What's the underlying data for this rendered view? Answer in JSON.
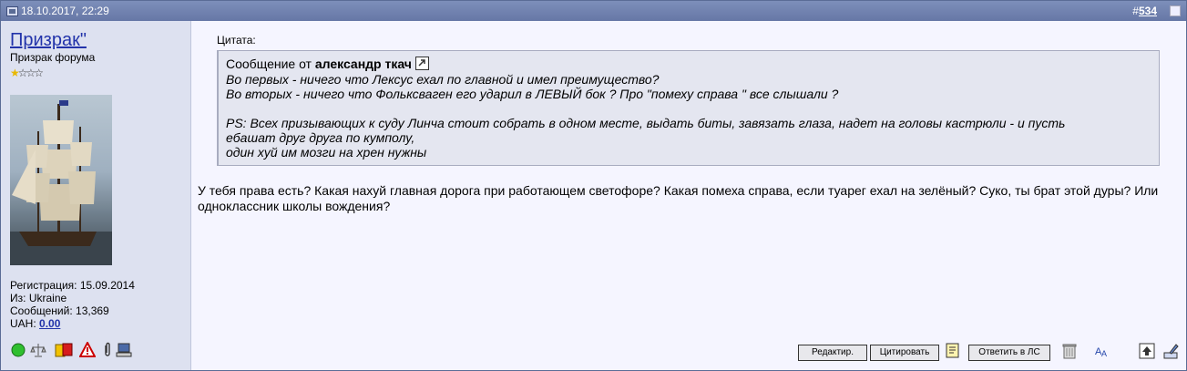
{
  "header": {
    "date": "18.10.2017, 22:29",
    "post_number_prefix": "#",
    "post_number": "534"
  },
  "user": {
    "name": "Призрак\"",
    "title": "Призрак форума",
    "stars": [
      "★",
      "☆",
      "☆",
      "☆"
    ],
    "reg_label": "Регистрация:",
    "reg_value": "15.09.2014",
    "from_label": "Из:",
    "from_value": "Ukraine",
    "msgs_label": "Сообщений:",
    "msgs_value": "13,369",
    "uah_label": "UAH:",
    "uah_value": "0.00"
  },
  "quote": {
    "label": "Цитата:",
    "from_prefix": "Сообщение от",
    "author": "александр ткач",
    "lines": [
      "Во первых - ничего что Лексус ехал по главной и имел преимущество?",
      "Во вторых - ничего что Фольксваген его ударил в ЛЕВЫЙ бок ? Про \"помеху справа \" все слышали ?",
      "",
      "PS: Всех призывающих к суду Линча стоит собрать в одном месте, выдать биты, завязать глаза, надет на головы кастрюли - и пусть",
      "ебашат друг друга по кумполу,",
      "один хуй им мозги на хрен нужны"
    ]
  },
  "message": "У тебя права есть? Какая нахуй главная дорога при работающем светофоре? Какая помеха справа, если туарег ехал на зелёный? Суко, ты брат этой дуры? Или одноклассник школы вождения?",
  "buttons": {
    "edit": "Редактир.",
    "quote": "Цитировать",
    "reply_pm": "Ответить в ЛС"
  },
  "colors": {
    "header_bg": "#6677a6",
    "user_col_bg": "#dde1f0",
    "post_bg": "#f5f5ff",
    "quote_bg": "#e4e6f0",
    "link": "#2233aa"
  }
}
